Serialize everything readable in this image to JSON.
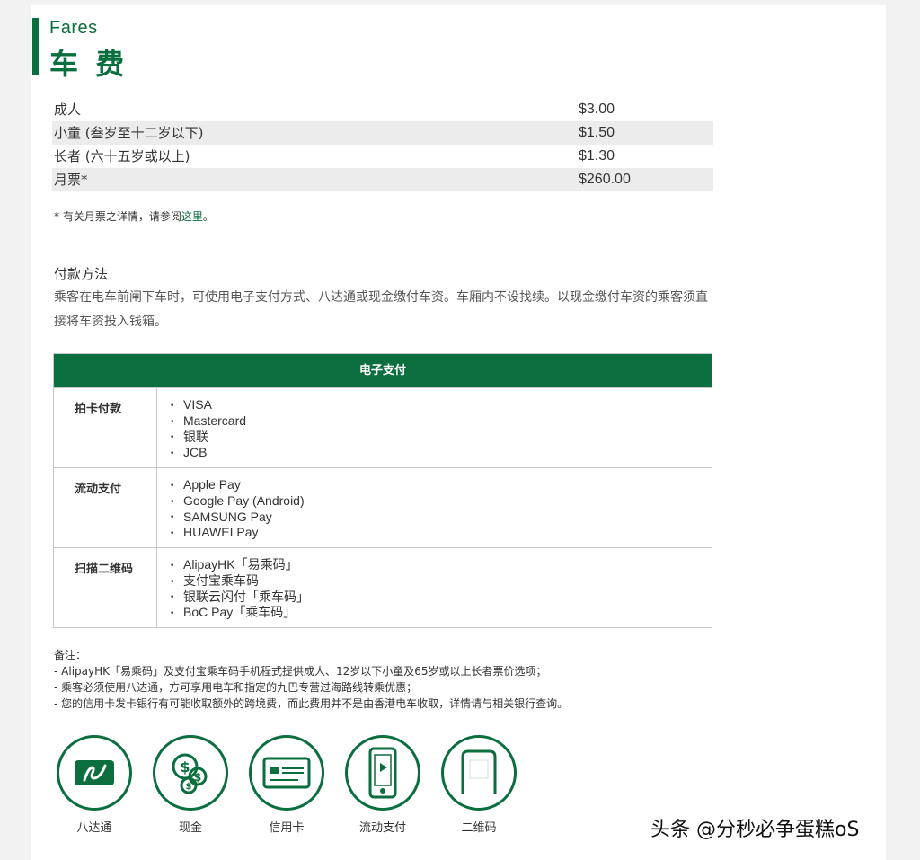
{
  "header": {
    "title_en": "Fares",
    "title_zh": "车 费"
  },
  "fares": [
    {
      "label": "成人",
      "amount": "$3.00"
    },
    {
      "label": "小童 (叁岁至十二岁以下)",
      "amount": "$1.50"
    },
    {
      "label": "长者 (六十五岁或以上)",
      "amount": "$1.30"
    },
    {
      "label": "月票*",
      "amount": "$260.00"
    }
  ],
  "note": {
    "text": "* 有关月票之详情，请参阅",
    "link": "这里",
    "end": "。"
  },
  "payment": {
    "heading": "付款方法",
    "description": "乘客在电车前闸下车时，可使用电子支付方式、八达通或现金缴付车资。车厢内不设找续。以现金缴付车资的乘客须直接将车资投入钱箱。"
  },
  "table": {
    "header": "电子支付",
    "rows": [
      {
        "category": "拍卡付款",
        "items": [
          "VISA",
          "Mastercard",
          "银联",
          "JCB"
        ]
      },
      {
        "category": "流动支付",
        "items": [
          "Apple Pay",
          "Google Pay (Android)",
          "SAMSUNG Pay",
          "HUAWEI Pay"
        ]
      },
      {
        "category": "扫描二维码",
        "items": [
          "AlipayHK「易乘码」",
          "支付宝乘车码",
          "银联云闪付「乘车码」",
          "BoC Pay「乘车码」"
        ]
      }
    ]
  },
  "remarks": {
    "title": "备注：",
    "lines": [
      "- AlipayHK「易乘码」及支付宝乘车码手机程式提供成人、12岁以下小童及65岁或以上长者票价选项；",
      "- 乘客必须使用八达通，方可享用电车和指定的九巴专营过海路线转乘优惠；",
      "- 您的信用卡发卡银行有可能收取额外的跨境费，而此费用并不是由香港电车收取，详情请与相关银行查询。"
    ]
  },
  "icons": [
    {
      "name": "octopus-icon",
      "caption": "八达通"
    },
    {
      "name": "cash-icon",
      "caption": "现金"
    },
    {
      "name": "credit-card-icon",
      "caption": "信用卡"
    },
    {
      "name": "mobile-payment-icon",
      "caption": "流动支付"
    },
    {
      "name": "qr-code-icon",
      "caption": "二维码"
    }
  ],
  "watermark": "头条 @分秒必争蛋糕oS",
  "colors": {
    "brand": "#0a6e3e",
    "stripe": "#ececec"
  }
}
